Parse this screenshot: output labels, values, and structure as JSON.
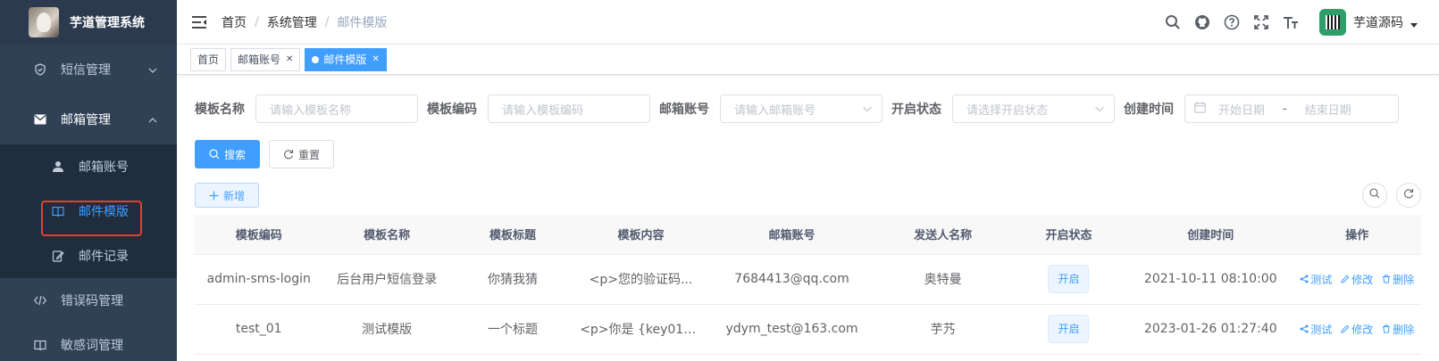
{
  "app": {
    "title": "芋道管理系统"
  },
  "sidebar": {
    "items": [
      {
        "label": "短信管理",
        "icon": "shield-icon",
        "expanded": false
      },
      {
        "label": "邮箱管理",
        "icon": "mail-icon",
        "expanded": true,
        "children": [
          {
            "label": "邮箱账号",
            "icon": "user-icon",
            "active": false
          },
          {
            "label": "邮件模版",
            "icon": "book-icon",
            "active": true
          },
          {
            "label": "邮件记录",
            "icon": "edit-icon",
            "active": false
          }
        ]
      },
      {
        "label": "错误码管理",
        "icon": "code-icon",
        "expanded": false
      },
      {
        "label": "敏感词管理",
        "icon": "book-icon",
        "expanded": false
      }
    ]
  },
  "breadcrumb": [
    "首页",
    "系统管理",
    "邮件模版"
  ],
  "header": {
    "username": "芋道源码"
  },
  "tags": [
    {
      "label": "首页",
      "active": false,
      "closable": false
    },
    {
      "label": "邮箱账号",
      "active": false,
      "closable": true
    },
    {
      "label": "邮件模版",
      "active": true,
      "closable": true
    }
  ],
  "search": {
    "fields": [
      {
        "label": "模板名称",
        "placeholder": "请输入模板名称",
        "type": "input"
      },
      {
        "label": "模板编码",
        "placeholder": "请输入模板编码",
        "type": "input"
      },
      {
        "label": "邮箱账号",
        "placeholder": "请输入邮箱账号",
        "type": "select"
      },
      {
        "label": "开启状态",
        "placeholder": "请选择开启状态",
        "type": "select"
      }
    ],
    "date": {
      "label": "创建时间",
      "start_placeholder": "开始日期",
      "separator": "-",
      "end_placeholder": "结束日期"
    },
    "search_btn": "搜索",
    "reset_btn": "重置"
  },
  "toolbar": {
    "add_btn": "新增"
  },
  "table": {
    "columns": [
      "模板编码",
      "模板名称",
      "模板标题",
      "模板内容",
      "邮箱账号",
      "发送人名称",
      "开启状态",
      "创建时间",
      "操作"
    ],
    "rows": [
      {
        "code": "admin-sms-login",
        "name": "后台用户短信登录",
        "title": "你猜我猜",
        "content": "<p>您的验证码...",
        "account": "7684413@qq.com",
        "sender": "奥特曼",
        "status": "开启",
        "created": "2021-10-11 08:10:00"
      },
      {
        "code": "test_01",
        "name": "测试模版",
        "title": "一个标题",
        "content": "<p>你是 {key01} ...",
        "account": "ydym_test@163.com",
        "sender": "芋艿",
        "status": "开启",
        "created": "2023-01-26 01:27:40"
      }
    ],
    "actions": {
      "test": "测试",
      "edit": "修改",
      "delete": "删除"
    }
  }
}
